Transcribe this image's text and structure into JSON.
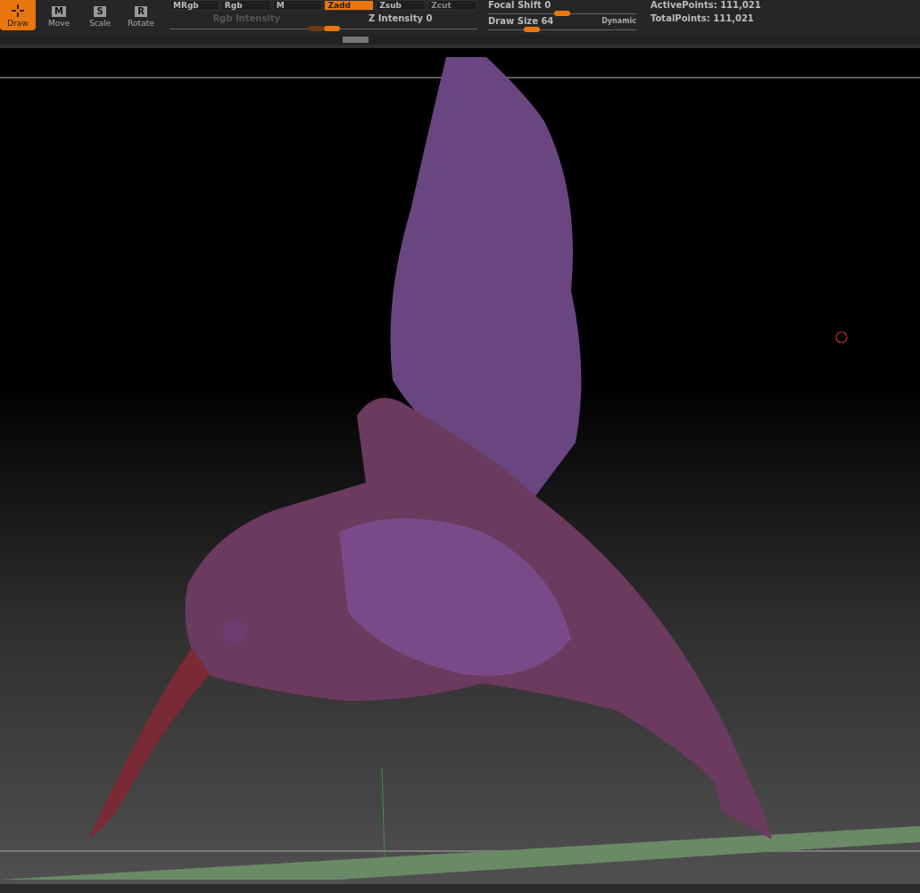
{
  "tools": [
    {
      "label": "Draw",
      "selected": true
    },
    {
      "label": "Move",
      "key": "M",
      "selected": false
    },
    {
      "label": "Scale",
      "key": "S",
      "selected": false
    },
    {
      "label": "Rotate",
      "key": "R",
      "selected": false
    }
  ],
  "modes": [
    {
      "label": "MRgb",
      "selected": false,
      "disabled": false
    },
    {
      "label": "Rgb",
      "selected": false,
      "disabled": false
    },
    {
      "label": "M",
      "selected": false,
      "disabled": false
    },
    {
      "label": "Zadd",
      "selected": true,
      "disabled": false
    },
    {
      "label": "Zsub",
      "selected": false,
      "disabled": false
    },
    {
      "label": "Zcut",
      "selected": false,
      "disabled": true
    }
  ],
  "sliders": [
    {
      "label": "Rgb Intensity",
      "level": 1,
      "disabled": true
    },
    {
      "label": "Z Intensity",
      "value": "0",
      "level": 0,
      "disabled": false
    }
  ],
  "brush_sliders": [
    {
      "label": "Focal Shift",
      "value": "0",
      "level": 0.5
    },
    {
      "label": "Draw Size",
      "value": "64",
      "level": 0.27,
      "tag": "Dynamic"
    }
  ],
  "stats": [
    {
      "label": "ActivePoints:",
      "value": "111,021"
    },
    {
      "label": "TotalPoints:",
      "value": "111,021"
    }
  ]
}
